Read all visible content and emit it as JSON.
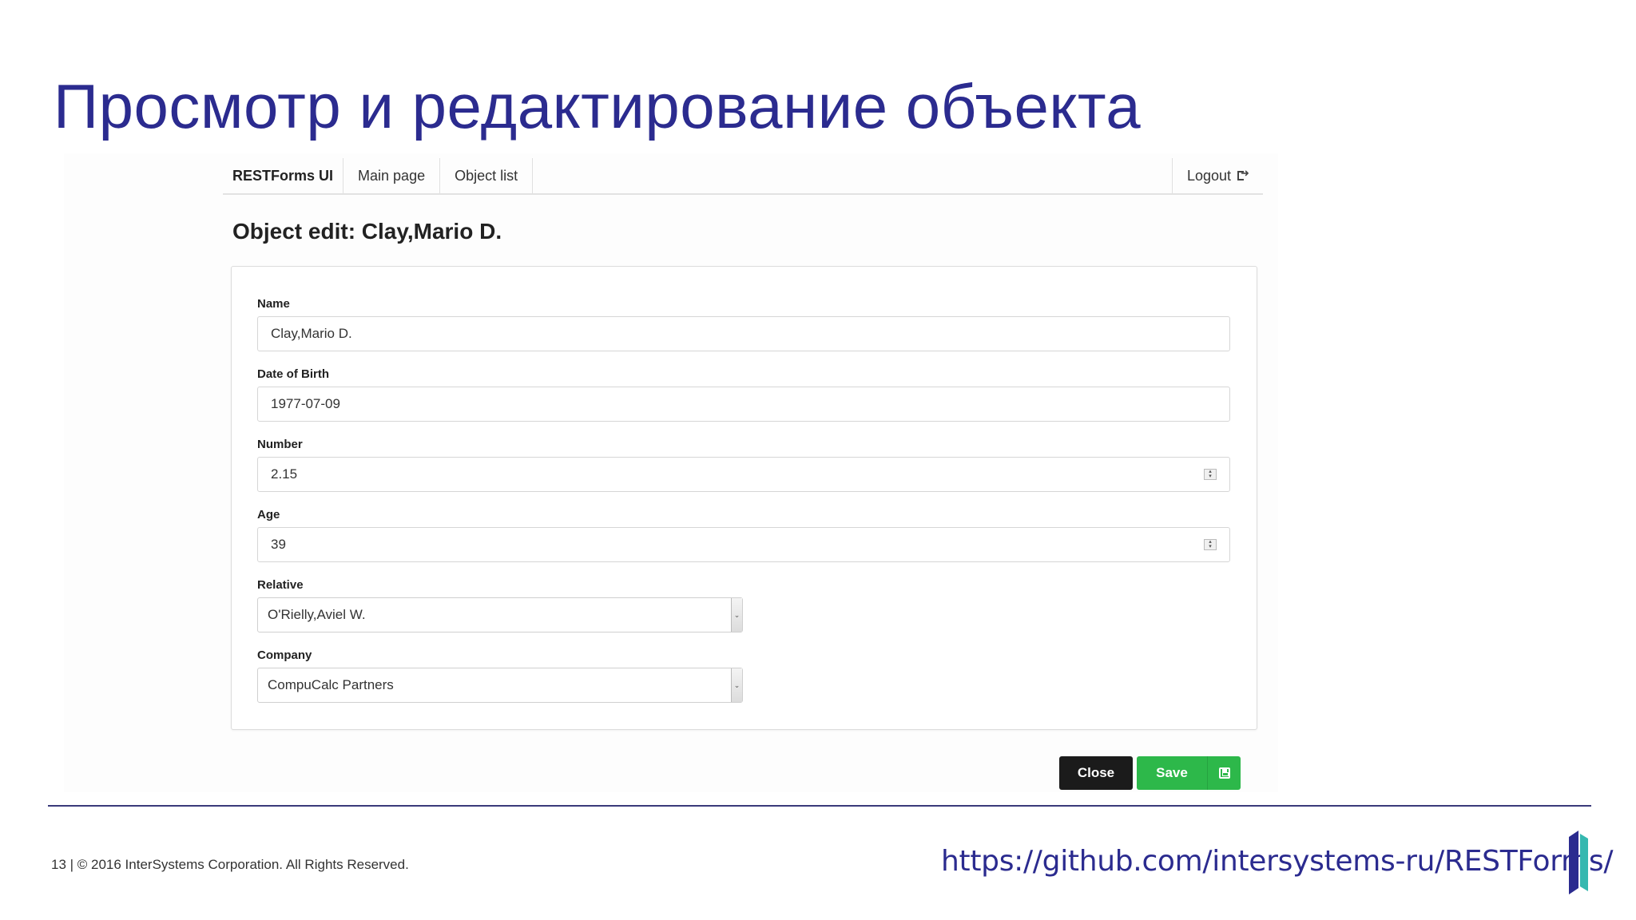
{
  "slide": {
    "title": "Просмотр и редактирование объекта",
    "footer_text": "13  |  © 2016 InterSystems Corporation. All Rights Reserved.",
    "footer_url": "https://github.com/intersystems-ru/RESTForms/"
  },
  "navbar": {
    "brand": "RESTForms UI",
    "items": [
      {
        "label": "Main page"
      },
      {
        "label": "Object list"
      }
    ],
    "logout_label": "Logout"
  },
  "page_heading": "Object edit: Clay,Mario D.",
  "form": {
    "fields": [
      {
        "label": "Name",
        "value": "Clay,Mario D."
      },
      {
        "label": "Date of Birth",
        "value": "1977-07-09"
      },
      {
        "label": "Number",
        "value": "2.15"
      },
      {
        "label": "Age",
        "value": "39"
      },
      {
        "label": "Relative",
        "value": "O'Rielly,Aviel W."
      },
      {
        "label": "Company",
        "value": "CompuCalc Partners"
      }
    ]
  },
  "buttons": {
    "close_label": "Close",
    "save_label": "Save"
  },
  "colors": {
    "title": "#2b2b8f",
    "save_button": "#2db84a",
    "close_button": "#1b1b1b"
  }
}
